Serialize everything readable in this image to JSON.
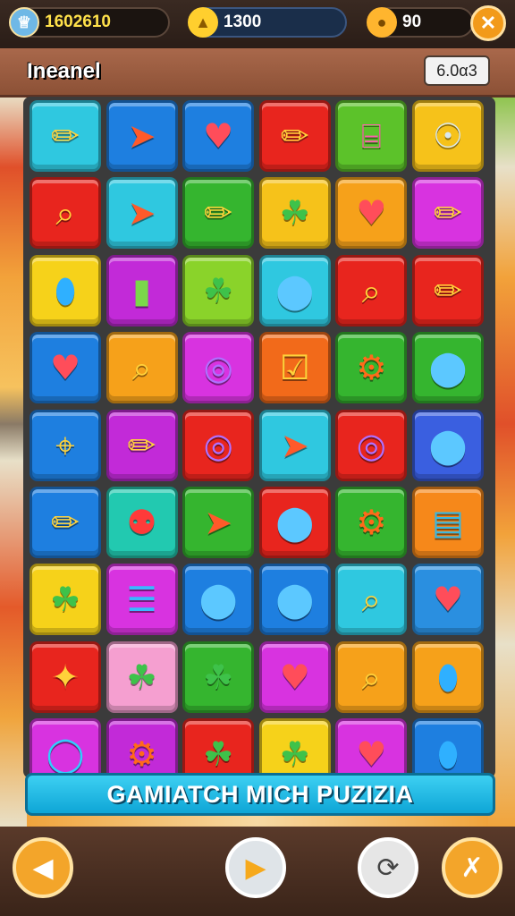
{
  "hud": {
    "score": "1602610",
    "gems": "1300",
    "coins": "90",
    "score_icon": "treasure-chest-icon",
    "gems_icon": "boot-icon",
    "coins_icon": "coin-icon",
    "close_icon": "close-icon"
  },
  "title_bar": {
    "level_name": "Ineanel",
    "timer": "6.0α3"
  },
  "banner": {
    "text": "GAMIATCH MICH PUZIZIA"
  },
  "bottom_bar": {
    "buttons": [
      "back-icon",
      "play-icon",
      "restart-icon",
      "tools-icon"
    ]
  },
  "board": {
    "columns": 6,
    "rows": [
      [
        {
          "icon": "pencil-icon",
          "color": "#2fc8e0"
        },
        {
          "icon": "arrow-icon",
          "color": "#1e7fe0"
        },
        {
          "icon": "heart-icon",
          "color": "#1e7fe0"
        },
        {
          "icon": "pencil-icon",
          "color": "#e8251e"
        },
        {
          "icon": "jar-icon",
          "color": "#5cc22a"
        },
        {
          "icon": "radio-icon",
          "color": "#f6c21a"
        }
      ],
      [
        {
          "icon": "magnifier-icon",
          "color": "#e8251e"
        },
        {
          "icon": "arrow-icon",
          "color": "#2fc8e0"
        },
        {
          "icon": "pencil-icon",
          "color": "#35b52f"
        },
        {
          "icon": "leaf-icon",
          "color": "#f6c21a"
        },
        {
          "icon": "heart-icon",
          "color": "#f6a11a"
        },
        {
          "icon": "pencil-icon",
          "color": "#d833e0"
        }
      ],
      [
        {
          "icon": "balloon-icon",
          "color": "#f6d21a"
        },
        {
          "icon": "battery-icon",
          "color": "#c22ad8"
        },
        {
          "icon": "leaf-icon",
          "color": "#8ad32a"
        },
        {
          "icon": "bulb-icon",
          "color": "#2fc8e0"
        },
        {
          "icon": "magnifier-icon",
          "color": "#e8251e"
        },
        {
          "icon": "pencil-icon",
          "color": "#e8251e"
        }
      ],
      [
        {
          "icon": "heart-icon",
          "color": "#1e7fe0"
        },
        {
          "icon": "magnifier-icon",
          "color": "#f6a11a"
        },
        {
          "icon": "spiral-icon",
          "color": "#d833e0"
        },
        {
          "icon": "check-icon",
          "color": "#f26a1a"
        },
        {
          "icon": "gear-icon",
          "color": "#35b52f"
        },
        {
          "icon": "bulb-icon",
          "color": "#35b52f"
        }
      ],
      [
        {
          "icon": "pin-icon",
          "color": "#1e7fe0"
        },
        {
          "icon": "pencil-icon",
          "color": "#c22ad8"
        },
        {
          "icon": "spiral-icon",
          "color": "#e8251e"
        },
        {
          "icon": "arrow-icon",
          "color": "#2fc8e0"
        },
        {
          "icon": "spiral-icon",
          "color": "#e8251e"
        },
        {
          "icon": "bulb-icon",
          "color": "#3a5fe0"
        }
      ],
      [
        {
          "icon": "pencil-icon",
          "color": "#1e7fe0"
        },
        {
          "icon": "lollipop-icon",
          "color": "#22c9b0"
        },
        {
          "icon": "arrow-icon",
          "color": "#35b52f"
        },
        {
          "icon": "bulb-icon",
          "color": "#e8251e"
        },
        {
          "icon": "gear-icon",
          "color": "#35b52f"
        },
        {
          "icon": "briefcase-icon",
          "color": "#f6881a"
        }
      ],
      [
        {
          "icon": "leaf-icon",
          "color": "#f6d21a"
        },
        {
          "icon": "clipboard-icon",
          "color": "#d833e0"
        },
        {
          "icon": "bulb-icon",
          "color": "#1e7fe0"
        },
        {
          "icon": "bulb-icon",
          "color": "#1e7fe0"
        },
        {
          "icon": "magnifier-icon",
          "color": "#2fc8e0"
        },
        {
          "icon": "heart-icon",
          "color": "#2a8fe0"
        }
      ],
      [
        {
          "icon": "star-icon",
          "color": "#e8251e"
        },
        {
          "icon": "leaf-icon",
          "color": "#f59fd0"
        },
        {
          "icon": "leaf-icon",
          "color": "#35b52f"
        },
        {
          "icon": "heart-icon",
          "color": "#d833e0"
        },
        {
          "icon": "magnifier-icon",
          "color": "#f6a11a"
        },
        {
          "icon": "balloon-icon",
          "color": "#f6a11a"
        }
      ],
      [
        {
          "icon": "ring-icon",
          "color": "#d833e0"
        },
        {
          "icon": "gear-icon",
          "color": "#c22ad8"
        },
        {
          "icon": "leaf-icon",
          "color": "#e8251e"
        },
        {
          "icon": "leaf-icon",
          "color": "#f6d21a"
        },
        {
          "icon": "heart-icon",
          "color": "#d833e0"
        },
        {
          "icon": "balloon-icon",
          "color": "#1e7fe0"
        }
      ]
    ]
  }
}
